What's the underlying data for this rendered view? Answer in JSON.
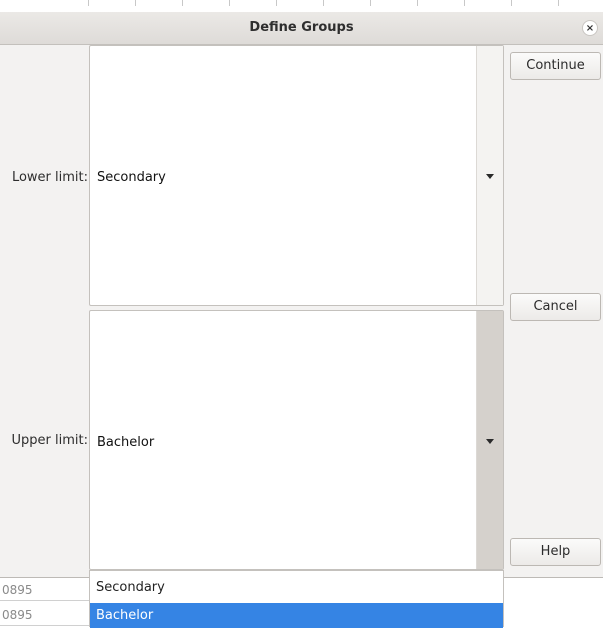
{
  "dialog": {
    "title": "Define Groups",
    "close_symbol": "×"
  },
  "lower_limit": {
    "label": "Lower limit:",
    "value": "Secondary"
  },
  "upper_limit": {
    "label": "Upper limit:",
    "value": "Bachelor"
  },
  "buttons": {
    "continue": "Continue",
    "cancel": "Cancel",
    "help": "Help"
  },
  "background_rows": [
    "0895",
    "0895"
  ],
  "dropdown": {
    "options": [
      "Secondary",
      "Bachelor"
    ],
    "selected": "Bachelor"
  },
  "colors": {
    "selection": "#3584e4",
    "dialog_bg": "#f3f2f1"
  }
}
